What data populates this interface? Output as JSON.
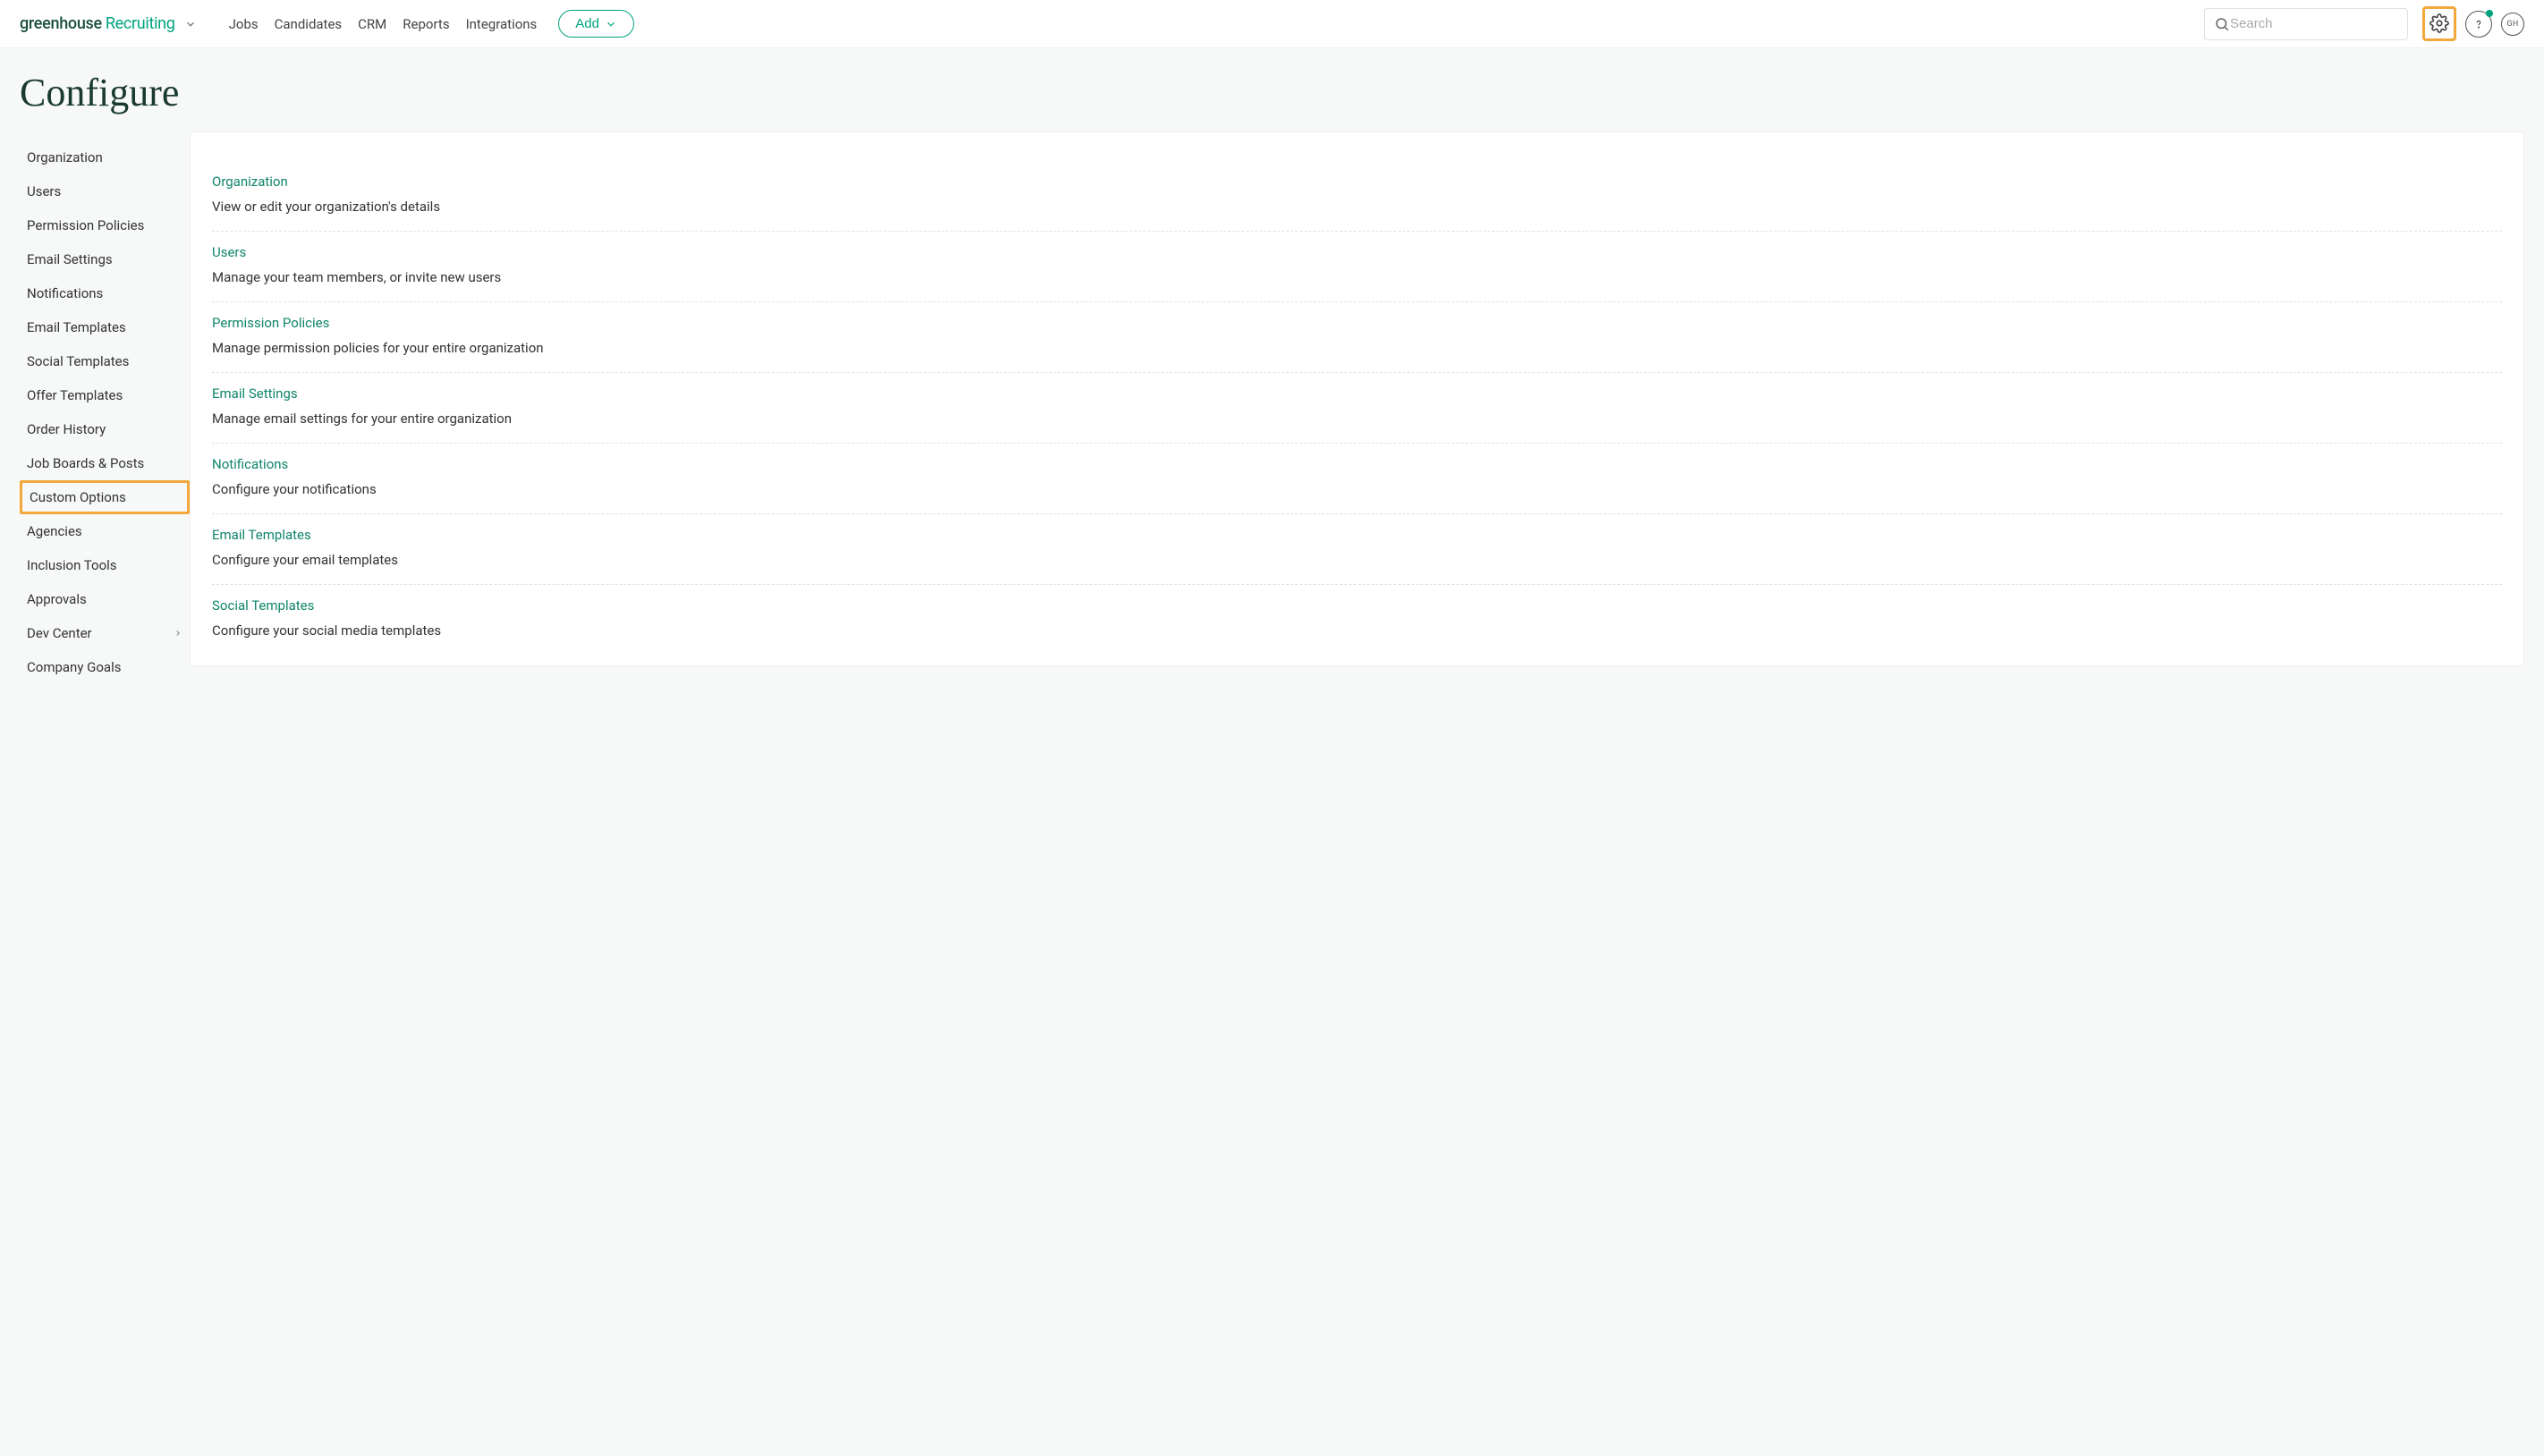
{
  "header": {
    "logo1": "greenhouse",
    "logo2": "Recruiting",
    "nav": [
      "Jobs",
      "Candidates",
      "CRM",
      "Reports",
      "Integrations"
    ],
    "add_label": "Add",
    "search_placeholder": "Search",
    "avatar_initials": "GH"
  },
  "page_title": "Configure",
  "sidebar": {
    "items": [
      {
        "label": "Organization",
        "highlighted": false,
        "chevron": false
      },
      {
        "label": "Users",
        "highlighted": false,
        "chevron": false
      },
      {
        "label": "Permission Policies",
        "highlighted": false,
        "chevron": false
      },
      {
        "label": "Email Settings",
        "highlighted": false,
        "chevron": false
      },
      {
        "label": "Notifications",
        "highlighted": false,
        "chevron": false
      },
      {
        "label": "Email Templates",
        "highlighted": false,
        "chevron": false
      },
      {
        "label": "Social Templates",
        "highlighted": false,
        "chevron": false
      },
      {
        "label": "Offer Templates",
        "highlighted": false,
        "chevron": false
      },
      {
        "label": "Order History",
        "highlighted": false,
        "chevron": false
      },
      {
        "label": "Job Boards & Posts",
        "highlighted": false,
        "chevron": false
      },
      {
        "label": "Custom Options",
        "highlighted": true,
        "chevron": false
      },
      {
        "label": "Agencies",
        "highlighted": false,
        "chevron": false
      },
      {
        "label": "Inclusion Tools",
        "highlighted": false,
        "chevron": false
      },
      {
        "label": "Approvals",
        "highlighted": false,
        "chevron": false
      },
      {
        "label": "Dev Center",
        "highlighted": false,
        "chevron": true
      },
      {
        "label": "Company Goals",
        "highlighted": false,
        "chevron": false
      }
    ]
  },
  "main": {
    "rows": [
      {
        "title": "Organization",
        "desc": "View or edit your organization's details"
      },
      {
        "title": "Users",
        "desc": "Manage your team members, or invite new users"
      },
      {
        "title": "Permission Policies",
        "desc": "Manage permission policies for your entire organization"
      },
      {
        "title": "Email Settings",
        "desc": "Manage email settings for your entire organization"
      },
      {
        "title": "Notifications",
        "desc": "Configure your notifications"
      },
      {
        "title": "Email Templates",
        "desc": "Configure your email templates"
      },
      {
        "title": "Social Templates",
        "desc": "Configure your social media templates"
      }
    ]
  }
}
